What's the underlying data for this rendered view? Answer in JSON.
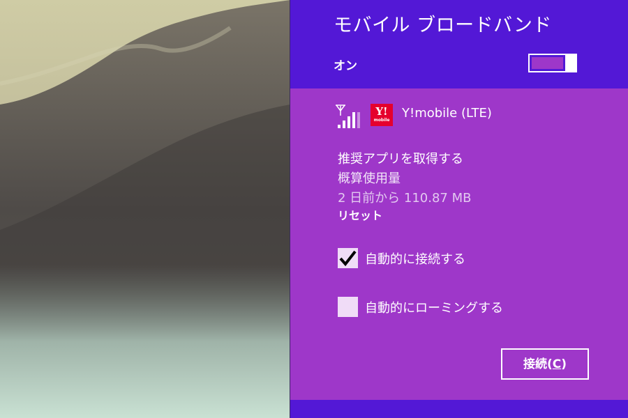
{
  "panel": {
    "title": "モバイル ブロードバンド",
    "toggle": {
      "label": "オン",
      "state": "on"
    },
    "network": {
      "brand_logo_text": "Y!",
      "brand_logo_subtext": "mobile",
      "name": "Y!mobile (LTE)",
      "signal_icon": "signal-strength-icon",
      "signal_level": 4
    },
    "details": {
      "get_app_link": "推奨アプリを取得する",
      "usage_label": "概算使用量",
      "usage_value": "2 日前から 110.87 MB",
      "reset_link": "リセット"
    },
    "options": [
      {
        "label": "自動的に接続する",
        "checked": true
      },
      {
        "label": "自動的にローミングする",
        "checked": false
      }
    ],
    "connect_button": {
      "label_prefix": "接続(",
      "label_accel": "C",
      "label_suffix": ")"
    }
  },
  "colors": {
    "header_bg": "#5318d6",
    "panel_bg": "#9e37c9",
    "brand_red": "#e5002d",
    "text": "#ffffff"
  }
}
